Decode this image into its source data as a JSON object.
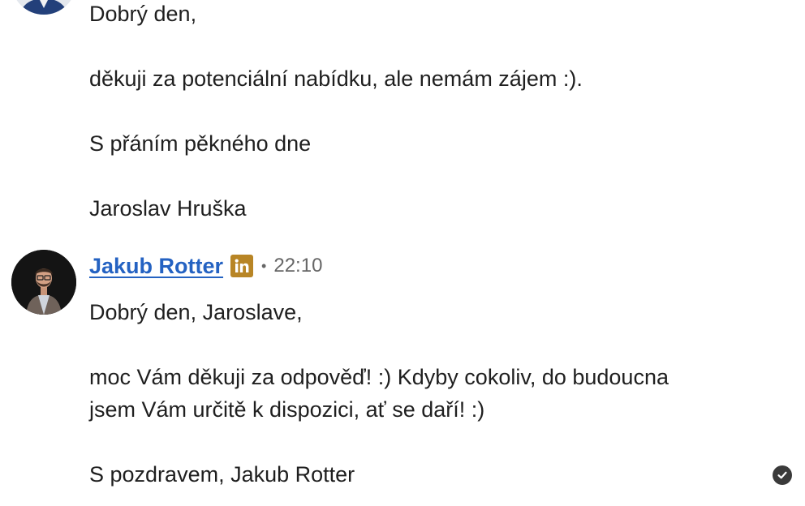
{
  "previous_message": {
    "avatar_icon": "profile-photo-icon",
    "greeting": "Dobrý den,",
    "body": "děkuji za potenciální nabídku, ale nemám zájem :).",
    "closing": "S přáním pěkného dne",
    "signature": "Jaroslav Hruška"
  },
  "reply_message": {
    "avatar_icon": "profile-photo-icon",
    "sender_name": "Jakub Rotter",
    "badge_icon": "linkedin-icon",
    "separator": "•",
    "timestamp": "22:10",
    "greeting": "Dobrý den, Jaroslave,",
    "body_line1": "moc Vám děkuji za odpověď! :) Kdyby cokoliv, do budoucna",
    "body_line2": "jsem Vám určitě k dispozici, ať se daří! :)",
    "signoff": "S pozdravem, Jakub Rotter",
    "status_icon": "read-checkmark-icon"
  },
  "colors": {
    "link_blue": "#2462c2",
    "linkedin_gold": "#b88525",
    "text": "#1f1f1f",
    "muted": "#666666"
  }
}
